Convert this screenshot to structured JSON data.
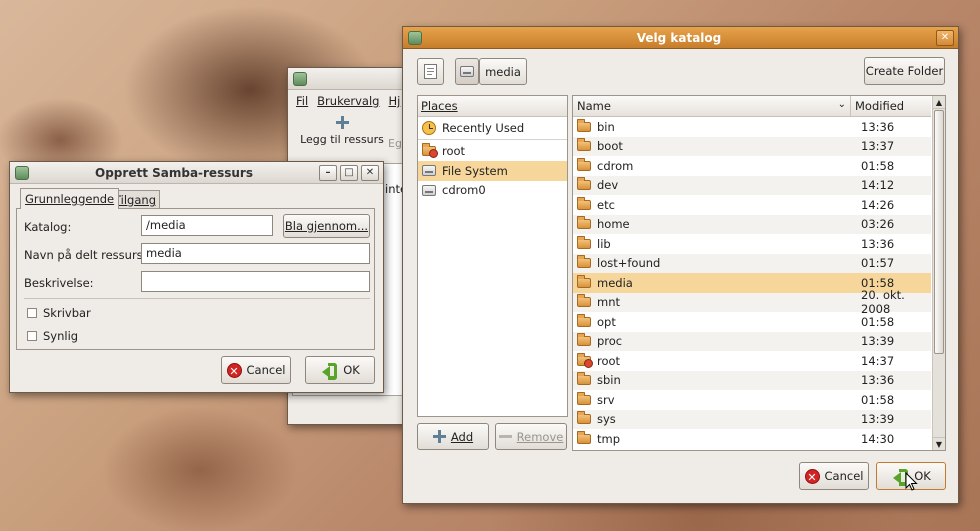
{
  "bg_window": {
    "menu": [
      "Fil",
      "Brukervalg",
      "Hj"
    ],
    "toolbar_add_label": "Legg til ressurs",
    "toolbar_second_label": "Eg",
    "partial_text": "inte"
  },
  "samba_dialog": {
    "title": "Opprett Samba-ressurs",
    "tabs": [
      "Grunnleggende",
      "Tilgang"
    ],
    "katalog_label": "Katalog:",
    "katalog_value": "/media",
    "browse_label": "Bla gjennom...",
    "navn_label": "Navn på delt ressurs",
    "navn_value": "media",
    "beskrivelse_label": "Beskrivelse:",
    "beskrivelse_value": "",
    "skrivbar_label": "Skrivbar",
    "synlig_label": "Synlig",
    "cancel_label": "Cancel",
    "ok_label": "OK"
  },
  "chooser": {
    "title": "Velg katalog",
    "path_button": "media",
    "create_folder_label": "Create Folder",
    "places_header": "Places",
    "places": [
      {
        "label": "Recently Used",
        "icon": "clock-icon"
      },
      {
        "label": "root",
        "icon": "home-folder-icon"
      },
      {
        "label": "File System",
        "icon": "drive-icon",
        "selected": true
      },
      {
        "label": "cdrom0",
        "icon": "cdrom-icon"
      }
    ],
    "add_label": "Add",
    "remove_label": "Remove",
    "col_name": "Name",
    "col_modified": "Modified",
    "files": [
      {
        "name": "bin",
        "modified": "13:36"
      },
      {
        "name": "boot",
        "modified": "13:37"
      },
      {
        "name": "cdrom",
        "modified": "01:58"
      },
      {
        "name": "dev",
        "modified": "14:12"
      },
      {
        "name": "etc",
        "modified": "14:26"
      },
      {
        "name": "home",
        "modified": "03:26"
      },
      {
        "name": "lib",
        "modified": "13:36"
      },
      {
        "name": "lost+found",
        "modified": "01:57"
      },
      {
        "name": "media",
        "modified": "01:58",
        "selected": true
      },
      {
        "name": "mnt",
        "modified": "20. okt. 2008"
      },
      {
        "name": "opt",
        "modified": "01:58"
      },
      {
        "name": "proc",
        "modified": "13:39"
      },
      {
        "name": "root",
        "modified": "14:37",
        "home": true
      },
      {
        "name": "sbin",
        "modified": "13:36"
      },
      {
        "name": "srv",
        "modified": "01:58"
      },
      {
        "name": "sys",
        "modified": "13:39"
      },
      {
        "name": "tmp",
        "modified": "14:30"
      }
    ],
    "cancel_label": "Cancel",
    "ok_label": "OK"
  },
  "colors": {
    "title_active": "#d88f3a",
    "selection": "#f6d69b"
  }
}
